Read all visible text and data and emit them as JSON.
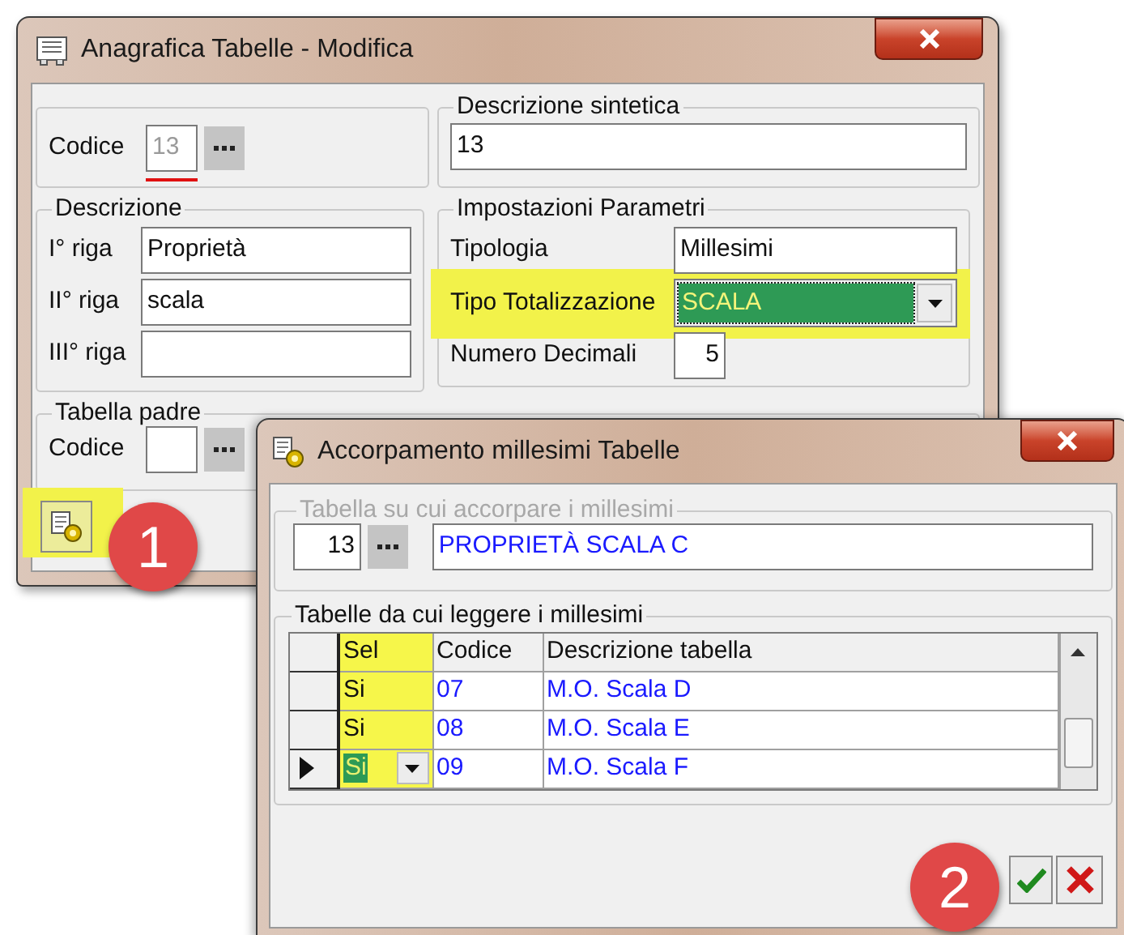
{
  "main_window": {
    "title": "Anagrafica Tabelle - Modifica",
    "codice": {
      "label": "Codice",
      "value": "13",
      "disabled": true
    },
    "descrizione_sintetica": {
      "title": "Descrizione sintetica",
      "value": "13"
    },
    "descrizione": {
      "title": "Descrizione",
      "rows": [
        {
          "label": "I° riga",
          "value": "Proprietà"
        },
        {
          "label": "II° riga",
          "value": "scala"
        },
        {
          "label": "III° riga"
        }
      ]
    },
    "impostazioni": {
      "title": "Impostazioni Parametri",
      "fields": [
        {
          "kind": "text",
          "label": "Tipologia",
          "value": "Millesimi",
          "highlighted": false
        },
        {
          "kind": "combo",
          "label": "Tipo Totalizzazione",
          "value": "SCALA",
          "highlighted": true
        },
        {
          "kind": "number",
          "label": "Numero Decimali",
          "value": "5",
          "highlighted": false
        }
      ]
    },
    "tabella_padre": {
      "title": "Tabella padre",
      "label": "Codice"
    },
    "toolbar": {
      "highlighted": true
    }
  },
  "accorpamento_window": {
    "title": "Accorpamento millesimi Tabelle",
    "target": {
      "title": "Tabella su cui accorpare i millesimi",
      "disabled": true,
      "codice": "13",
      "descrizione": "PROPRIETÀ SCALA C"
    },
    "sources": {
      "title": "Tabelle da cui leggere i millesimi",
      "columns": [
        {
          "label": "Sel",
          "highlighted": true
        },
        {
          "label": "Codice",
          "highlighted": false
        },
        {
          "label": "Descrizione tabella",
          "highlighted": false
        }
      ],
      "rows": [
        {
          "sel": "Si",
          "codice": "07",
          "descrizione": "M.O. Scala D",
          "current": false
        },
        {
          "sel": "Si",
          "codice": "08",
          "descrizione": "M.O. Scala E",
          "current": false
        },
        {
          "sel": "Si",
          "codice": "09",
          "descrizione": "M.O. Scala F",
          "current": true
        }
      ]
    }
  },
  "callouts": [
    {
      "label": "1"
    },
    {
      "label": "2"
    }
  ]
}
